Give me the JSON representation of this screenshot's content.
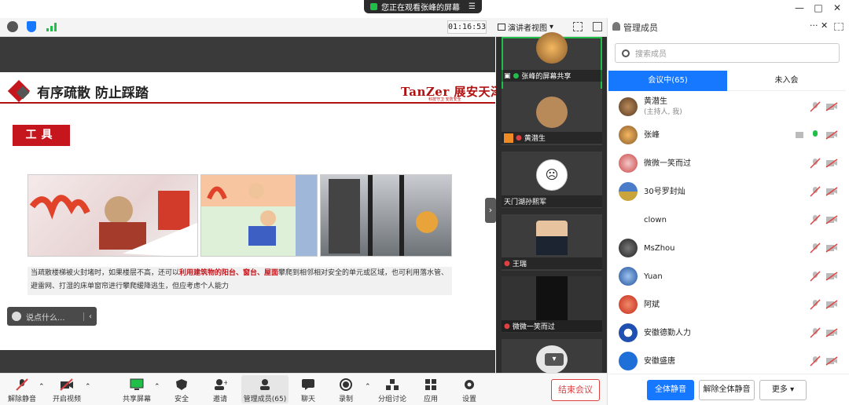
{
  "titlebar": {
    "share_notice": "您正在观看张峰的屏幕",
    "minimize": "—",
    "maximize": "□",
    "close": "✕"
  },
  "topbar": {
    "timer": "01:16:53",
    "view_mode": "演讲者视图"
  },
  "slide": {
    "title": "有序疏散 防止踩踏",
    "logo": "TanZer 展安天泽",
    "logo_sub": "科技守卫  安防安全",
    "tool_label": "工具",
    "caption_pre": "当疏散楼梯被火封堵时，如果楼层不高，还可以",
    "caption_hl": "利用建筑物的阳台、窗台、屋面",
    "caption_post": "攀爬到相邻相对安全的单元或区域，也可利用落水管、避雷网、打湿的床单窗帘进行攀爬缓降逃生，但应考虑个人能力"
  },
  "chat": {
    "placeholder": "说点什么..."
  },
  "videos": [
    {
      "name": "张峰的屏幕共享"
    },
    {
      "name": "黄潜生"
    },
    {
      "name": "天门湖孙熙军"
    },
    {
      "name": "王瑞"
    },
    {
      "name": "微微一笑而过"
    }
  ],
  "bottombar": {
    "mute": "解除静音",
    "video": "开启视频",
    "share": "共享屏幕",
    "security": "安全",
    "invite": "邀请",
    "members": "管理成员(65)",
    "chat": "聊天",
    "record": "录制",
    "breakout": "分组讨论",
    "apps": "应用",
    "settings": "设置",
    "end": "结束会议"
  },
  "panel": {
    "title": "管理成员",
    "search_placeholder": "搜索成员",
    "tab_in": "会议中(65)",
    "tab_out": "未入会",
    "members": [
      {
        "name": "黄潜生",
        "sub": "(主持人, 我)"
      },
      {
        "name": "张峰",
        "sub": ""
      },
      {
        "name": "微微一笑而过",
        "sub": ""
      },
      {
        "name": "30号罗封灿",
        "sub": ""
      },
      {
        "name": "clown",
        "sub": ""
      },
      {
        "name": "MsZhou",
        "sub": ""
      },
      {
        "name": "Yuan",
        "sub": ""
      },
      {
        "name": "阿斌",
        "sub": ""
      },
      {
        "name": "安徽德勤人力",
        "sub": ""
      },
      {
        "name": "安徽盛唐",
        "sub": ""
      }
    ],
    "mute_all": "全体静音",
    "unmute_all": "解除全体静音",
    "more": "更多"
  },
  "colors": {
    "accent": "#1677ff",
    "brand_red": "#c4161c",
    "end_red": "#e04040"
  }
}
